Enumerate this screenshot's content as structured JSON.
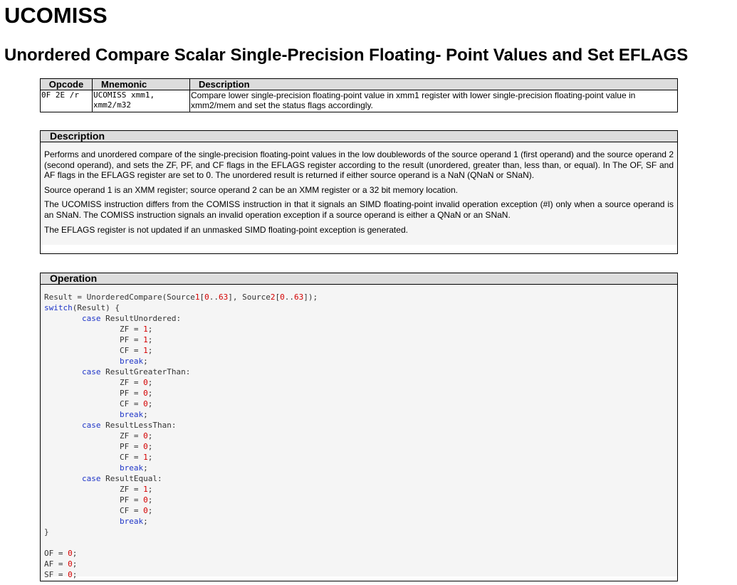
{
  "title": "UCOMISS",
  "subtitle": "Unordered Compare Scalar Single-Precision Floating- Point Values and Set EFLAGS",
  "opcode_table": {
    "headers": [
      "Opcode",
      "Mnemonic",
      "Description"
    ],
    "rows": [
      {
        "opcode": "0F 2E /r",
        "mnemonic": "UCOMISS xmm1, xmm2/m32",
        "description": "Compare lower single-precision floating-point value in xmm1 register with lower single-precision floating-point value in xmm2/mem and set the status flags accordingly."
      }
    ]
  },
  "description": {
    "heading": "Description",
    "paragraphs": [
      "Performs and unordered compare of the single-precision floating-point values in the low doublewords of the source operand 1 (first operand) and the source operand 2 (second operand), and sets the ZF, PF, and CF flags in the EFLAGS register according to the result (unordered, greater than, less than, or equal). In The OF, SF and AF flags in the EFLAGS register are set to 0. The unordered result is returned if either source operand is a NaN (QNaN or SNaN).",
      "Source operand 1 is an XMM register; source operand 2 can be an XMM register or a 32 bit memory location.",
      "The UCOMISS instruction differs from the COMISS instruction in that it signals an SIMD floating-point invalid operation exception (#I) only when a source operand is an SNaN. The COMISS instruction signals an invalid operation exception if a source operand is either a QNaN or an SNaN.",
      "The EFLAGS register is not updated if an unmasked SIMD floating-point exception is generated."
    ]
  },
  "operation": {
    "heading": "Operation",
    "code_lines": [
      "Result = UnorderedCompare(Source1[0..63], Source2[0..63]);",
      "switch(Result) {",
      "\tcase ResultUnordered:",
      "\t\tZF = 1;",
      "\t\tPF = 1;",
      "\t\tCF = 1;",
      "\t\tbreak;",
      "\tcase ResultGreaterThan:",
      "\t\tZF = 0;",
      "\t\tPF = 0;",
      "\t\tCF = 0;",
      "\t\tbreak;",
      "\tcase ResultLessThan:",
      "\t\tZF = 0;",
      "\t\tPF = 0;",
      "\t\tCF = 1;",
      "\t\tbreak;",
      "\tcase ResultEqual:",
      "\t\tZF = 1;",
      "\t\tPF = 0;",
      "\t\tCF = 0;",
      "\t\tbreak;",
      "}",
      "",
      "OF = 0;",
      "AF = 0;",
      "SF = 0;"
    ],
    "keywords": [
      "switch",
      "case",
      "break"
    ],
    "colors": {
      "keyword": "#1e35c8",
      "number": "#d40000",
      "text": "#333333"
    }
  }
}
